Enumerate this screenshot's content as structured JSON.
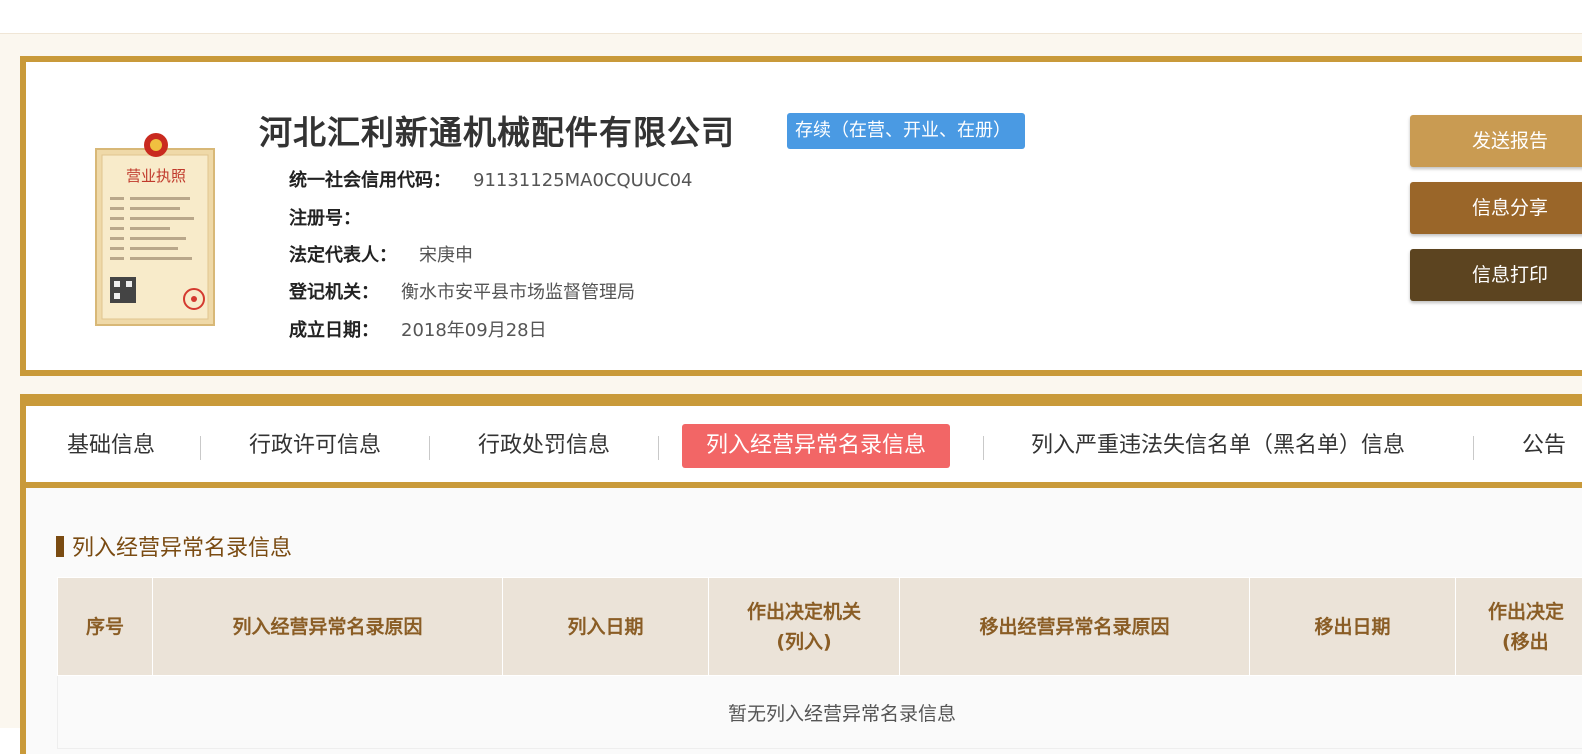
{
  "company": {
    "name": "河北汇利新通机械配件有限公司",
    "status": "存续（在营、开业、在册）",
    "fields": [
      {
        "label": "统一社会信用代码：",
        "value": "91131125MA0CQUUC04"
      },
      {
        "label": "注册号：",
        "value": ""
      },
      {
        "label": "法定代表人：",
        "value": "宋庚申"
      },
      {
        "label": "登记机关：",
        "value": "衡水市安平县市场监督管理局"
      },
      {
        "label": "成立日期：",
        "value": "2018年09月28日"
      }
    ],
    "license": {
      "title": "营业执照"
    }
  },
  "actions": [
    {
      "label": "发送报告",
      "color": "#c99b52"
    },
    {
      "label": "信息分享",
      "color": "#9a6629"
    },
    {
      "label": "信息打印",
      "color": "#5c4420"
    }
  ],
  "tabs": [
    {
      "label": "基础信息",
      "active": false
    },
    {
      "label": "行政许可信息",
      "active": false
    },
    {
      "label": "行政处罚信息",
      "active": false
    },
    {
      "label": "列入经营异常名录信息",
      "active": true
    },
    {
      "label": "列入严重违法失信名单（黑名单）信息",
      "active": false
    },
    {
      "label": "公告",
      "active": false
    }
  ],
  "section": {
    "title": "列入经营异常名录信息",
    "columns": [
      "序号",
      "列入经营异常名录原因",
      "列入日期",
      "作出决定机关\n(列入)",
      "移出经营异常名录原因",
      "移出日期",
      "作出决定\n(移出"
    ],
    "empty_text": "暂无列入经营异常名录信息"
  },
  "colors": {
    "gold_border": "#c99a3a",
    "status_blue": "#4a9ae3",
    "active_tab": "#f26666",
    "header_text": "#8a5d25"
  }
}
